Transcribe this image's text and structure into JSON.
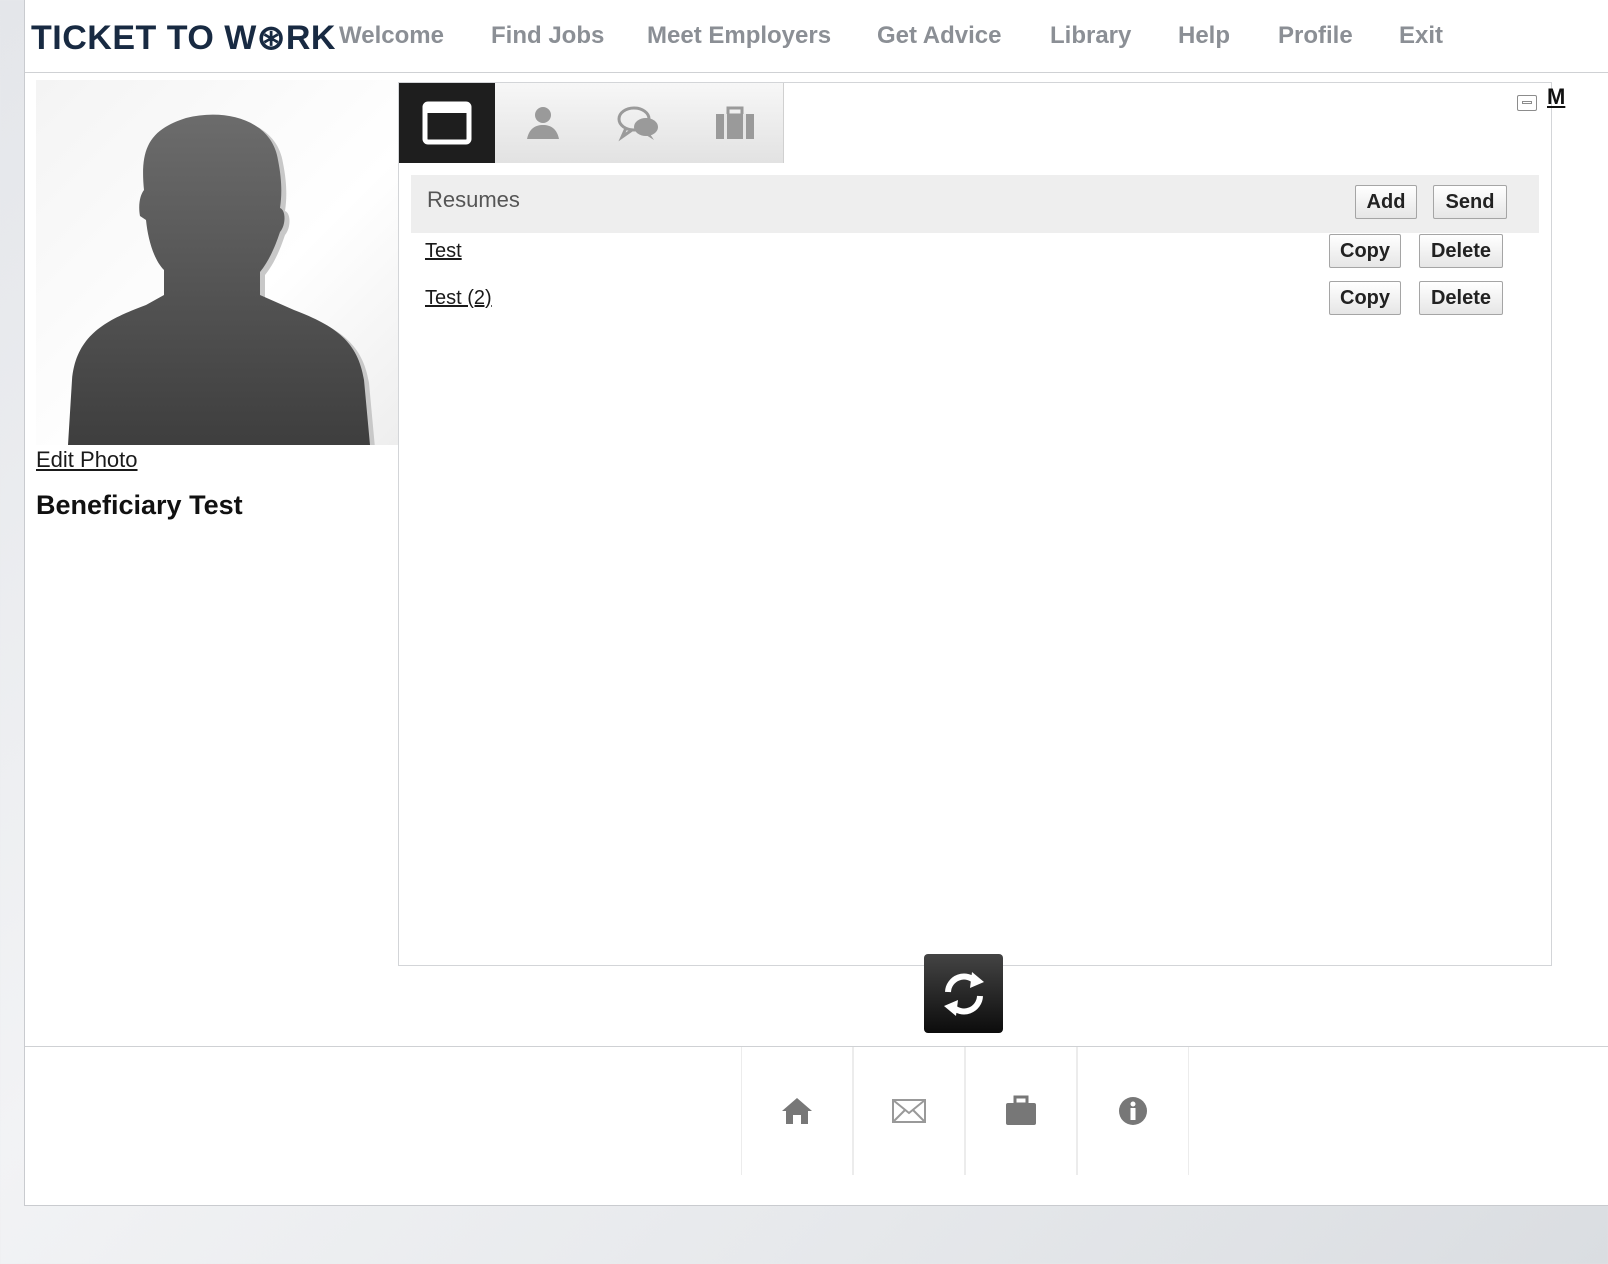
{
  "header": {
    "logo": "TICKET TO W⊛RK",
    "nav": [
      "Welcome",
      "Find Jobs",
      "Meet Employers",
      "Get Advice",
      "Library",
      "Help",
      "Profile",
      "Exit"
    ]
  },
  "profile": {
    "edit_photo": "Edit Photo",
    "name": "Beneficiary Test"
  },
  "panel": {
    "tabs": [
      {
        "icon": "window-icon",
        "active": true
      },
      {
        "icon": "person-icon",
        "active": false
      },
      {
        "icon": "chat-icon",
        "active": false
      },
      {
        "icon": "briefcase-icon",
        "active": false
      }
    ],
    "section_title": "Resumes",
    "add_label": "Add",
    "send_label": "Send",
    "resumes": [
      {
        "name": "Test",
        "copy": "Copy",
        "delete": "Delete"
      },
      {
        "name": "Test (2)",
        "copy": "Copy",
        "delete": "Delete"
      }
    ]
  },
  "right_stub": "M",
  "footer": {
    "icons": [
      "home-icon",
      "mail-icon",
      "briefcase-icon",
      "info-icon"
    ]
  }
}
